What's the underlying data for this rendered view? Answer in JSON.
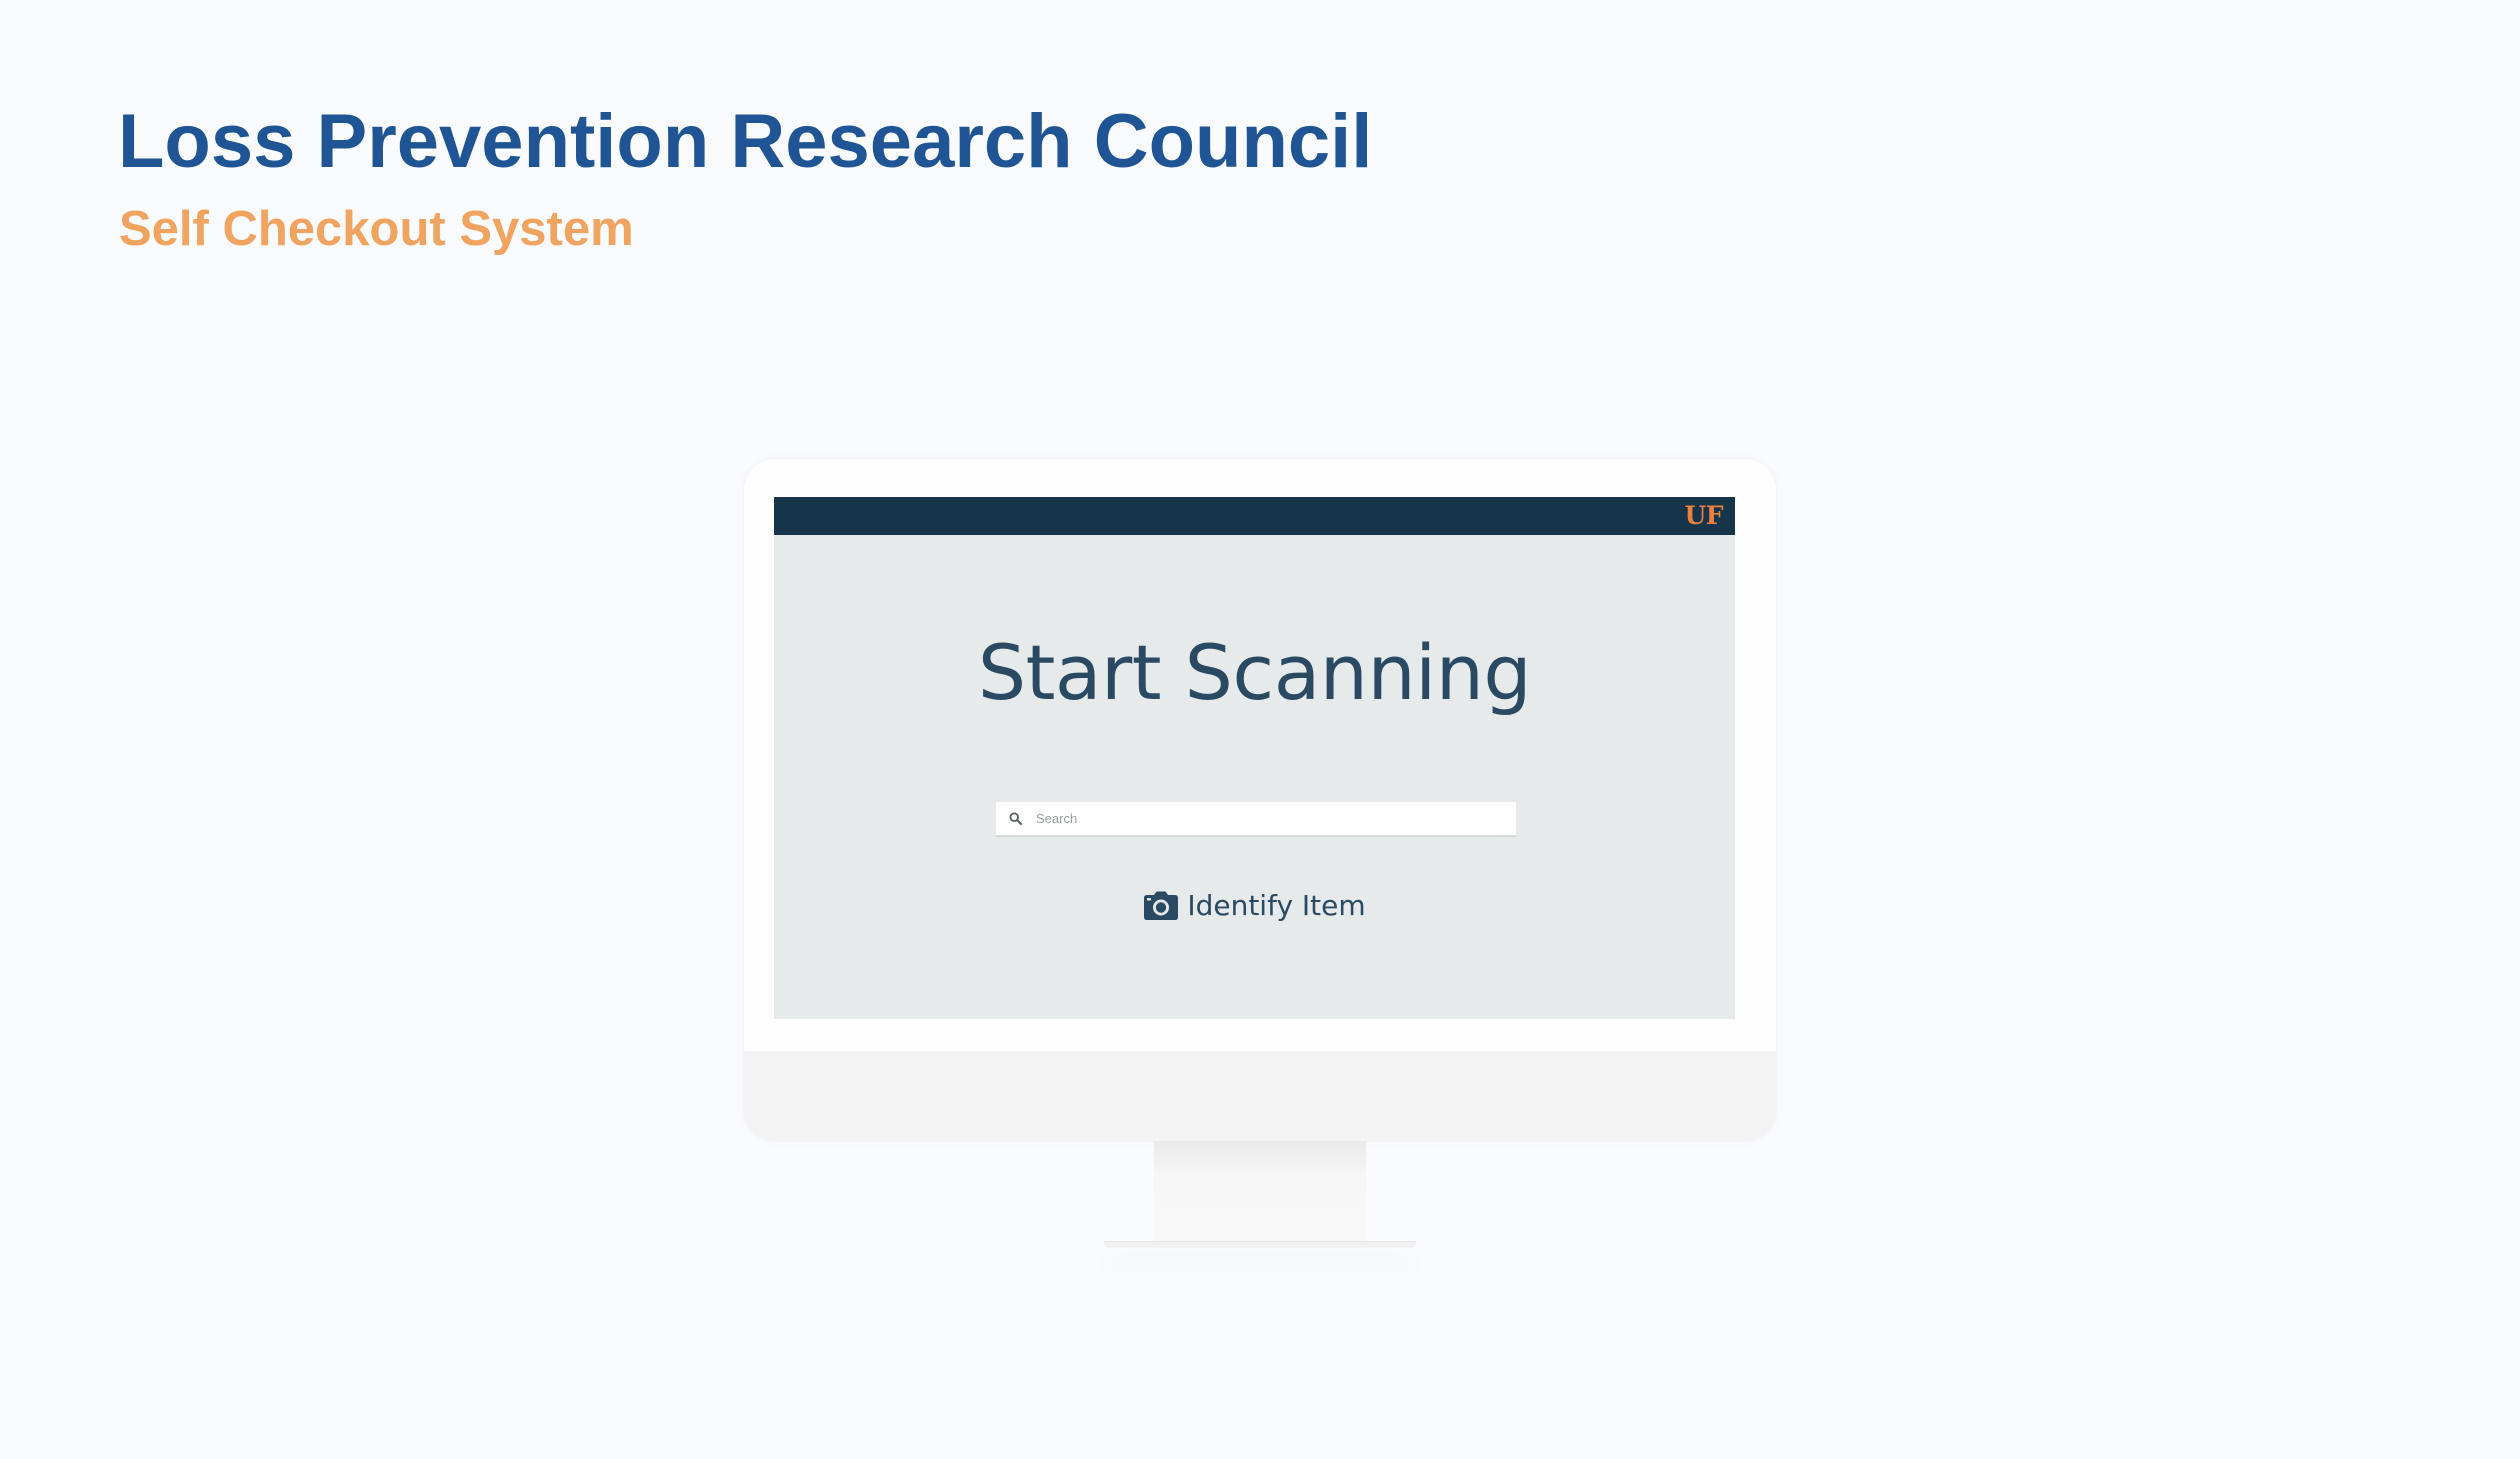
{
  "header": {
    "title": "Loss Prevention Research Council",
    "subtitle": "Self Checkout System"
  },
  "screen": {
    "logo": "UF",
    "heading": "Start Scanning",
    "search": {
      "placeholder": "Search",
      "value": "",
      "icon": "search-icon"
    },
    "identify_button": {
      "label": "Identify Item",
      "icon": "camera-icon"
    }
  },
  "colors": {
    "title": "#1f5595",
    "subtitle": "#f0a460",
    "topbar": "#16344a",
    "logo": "#ef7f3e",
    "screen_bg": "#e6eaeb",
    "screen_text": "#2a4a63"
  }
}
